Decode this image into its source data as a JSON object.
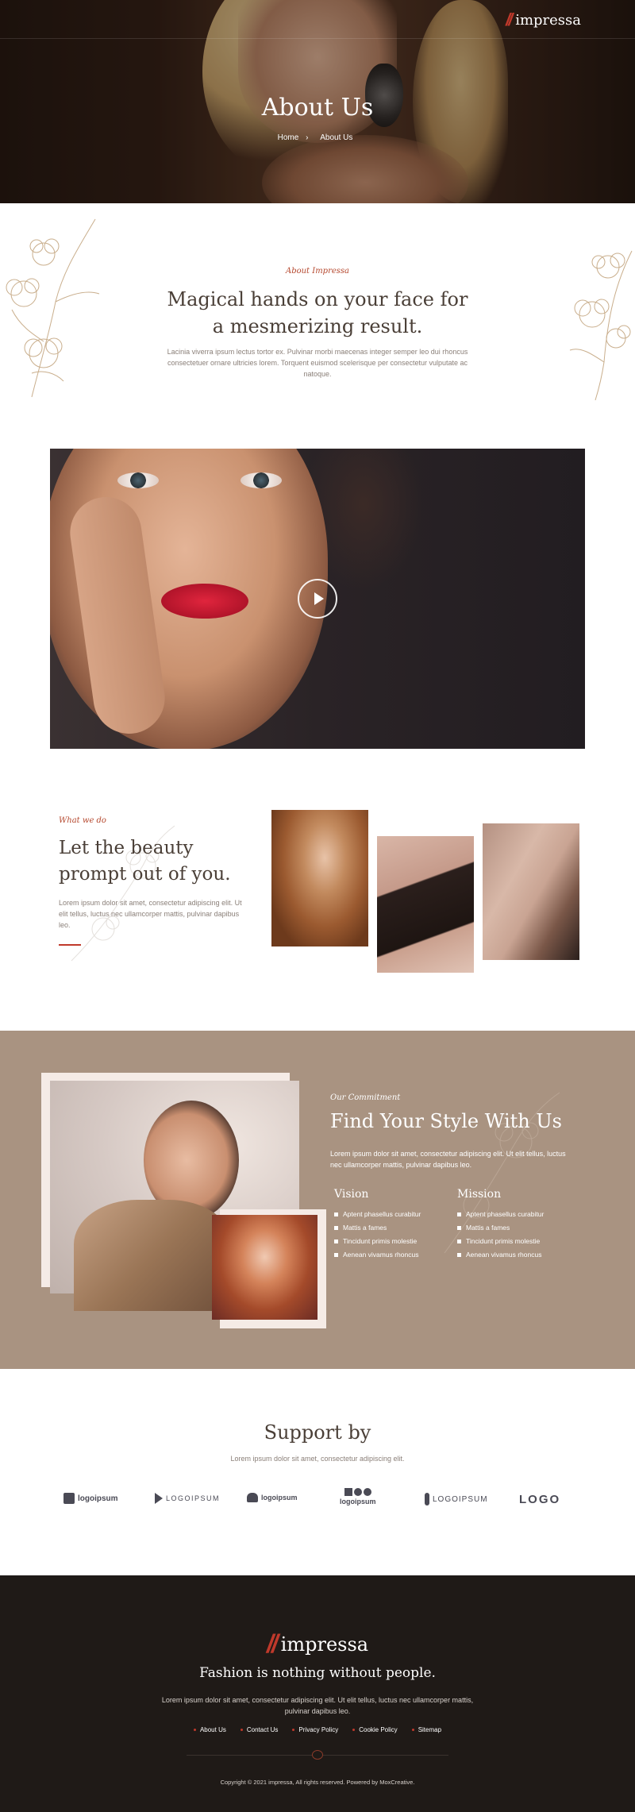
{
  "header": {
    "logo_text": "impressa",
    "logo_mark": "//",
    "title": "About Us",
    "breadcrumb": {
      "home": "Home",
      "separator": "›",
      "current": "About Us"
    }
  },
  "intro": {
    "eyebrow": "About Impressa",
    "heading": "Magical hands on your face for a mesmerizing result.",
    "body": "Lacinia viverra ipsum lectus tortor ex. Pulvinar morbi maecenas integer semper leo dui rhoncus consectetuer ornare ultricies lorem. Torquent euismod scelerisque per consectetur vulputate ac natoque.",
    "decor": "cotton-flower-line-art"
  },
  "video": {
    "play_icon": "play-icon"
  },
  "what_we_do": {
    "eyebrow": "What we do",
    "heading": "Let the beauty prompt out of you.",
    "body": "Lorem ipsum dolor sit amet, consectetur adipiscing elit. Ut elit tellus, luctus nec ullamcorper mattis, pulvinar dapibus leo."
  },
  "commitment": {
    "eyebrow": "Our Commitment",
    "heading": "Find Your Style With Us",
    "body": "Lorem ipsum dolor sit amet, consectetur adipiscing elit. Ut elit tellus, luctus nec ullamcorper mattis, pulvinar dapibus leo.",
    "vision": {
      "title": "Vision",
      "items": [
        "Aptent phasellus curabitur",
        "Mattis a fames",
        "Tincidunt primis molestie",
        "Aenean vivamus rhoncus"
      ]
    },
    "mission": {
      "title": "Mission",
      "items": [
        "Aptent phasellus curabitur",
        "Mattis a fames",
        "Tincidunt primis molestie",
        "Aenean vivamus rhoncus"
      ]
    }
  },
  "support": {
    "heading": "Support by",
    "body": "Lorem ipsum dolor sit amet, consectetur adipiscing elit.",
    "logos": [
      "logoipsum",
      "LOGOIPSUM",
      "logoipsum",
      "logoipsum",
      "LOGOIPSUM",
      "LOGO"
    ]
  },
  "footer": {
    "logo_text": "impressa",
    "tagline": "Fashion is nothing without people.",
    "body": "Lorem ipsum dolor sit amet, consectetur adipiscing elit. Ut elit tellus, luctus nec ullamcorper mattis, pulvinar dapibus leo.",
    "links": [
      "About Us",
      "Contact Us",
      "Privacy Policy",
      "Cookie Policy",
      "Sitemap"
    ],
    "copyright": "Copyright © 2021 impressa, All rights reserved. Powered by MoxCreative."
  },
  "colors": {
    "accent": "#c0392b",
    "commitment_bg": "#a99381",
    "footer_bg": "#1f1a17",
    "heading_text": "#4a3f37"
  }
}
